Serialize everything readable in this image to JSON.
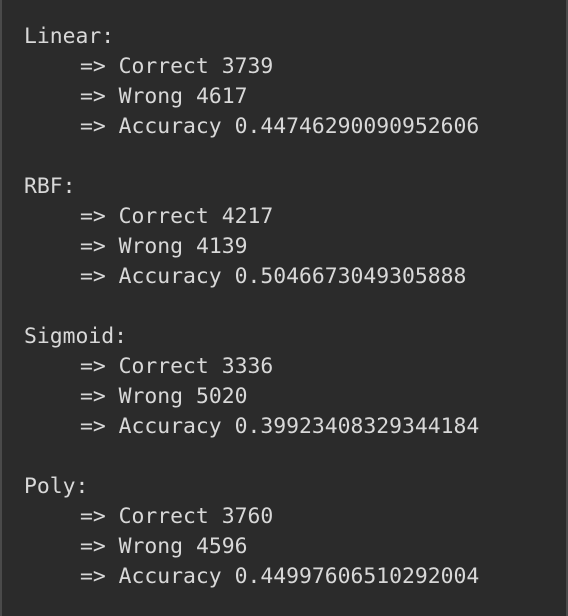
{
  "arrow": "=>",
  "results": [
    {
      "kernel": "Linear:",
      "correct_label": "Correct",
      "correct": "3739",
      "wrong_label": "Wrong",
      "wrong": "4617",
      "accuracy_label": "Accuracy",
      "accuracy": "0.44746290090952606"
    },
    {
      "kernel": "RBF:",
      "correct_label": "Correct",
      "correct": "4217",
      "wrong_label": "Wrong",
      "wrong": "4139",
      "accuracy_label": "Accuracy",
      "accuracy": "0.5046673049305888"
    },
    {
      "kernel": "Sigmoid:",
      "correct_label": "Correct",
      "correct": "3336",
      "wrong_label": "Wrong",
      "wrong": "5020",
      "accuracy_label": "Accuracy",
      "accuracy": "0.39923408329344184"
    },
    {
      "kernel": "Poly:",
      "correct_label": "Correct",
      "correct": "3760",
      "wrong_label": "Wrong",
      "wrong": "4596",
      "accuracy_label": "Accuracy",
      "accuracy": "0.44997606510292004"
    }
  ]
}
